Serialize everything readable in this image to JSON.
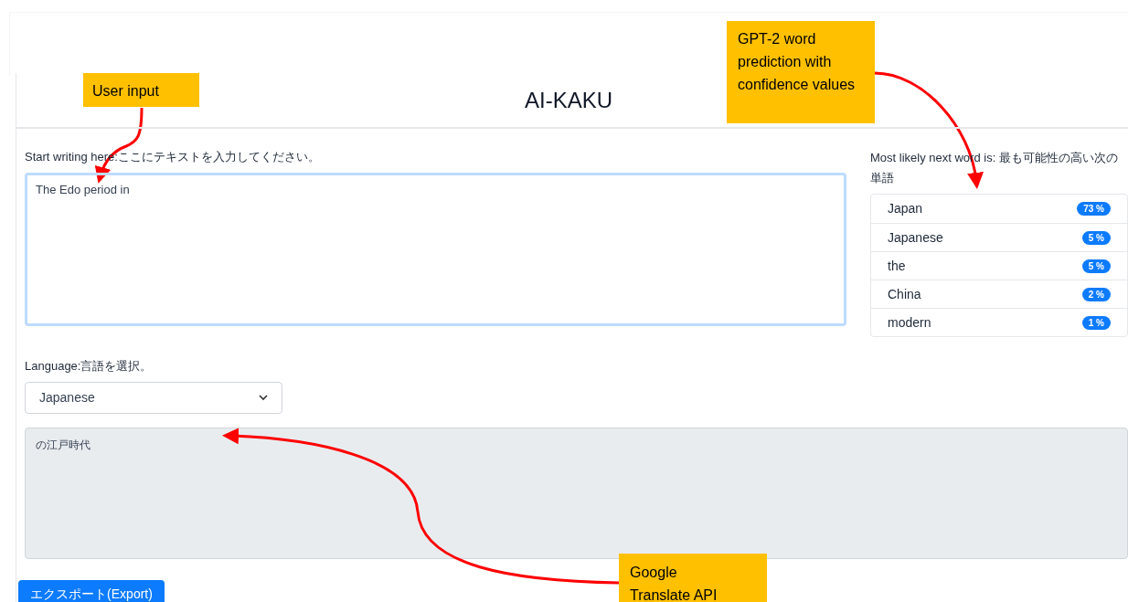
{
  "header": {
    "title": "AI-KAKU"
  },
  "input": {
    "label": "Start writing here:ここにテキストを入力してください。",
    "value": "The Edo period in"
  },
  "predictions": {
    "label": "Most likely next word is: 最も可能性の高い次の単語",
    "items": [
      {
        "word": "Japan",
        "confidence": "73 %"
      },
      {
        "word": "Japanese",
        "confidence": "5 %"
      },
      {
        "word": "the",
        "confidence": "5 %"
      },
      {
        "word": "China",
        "confidence": "2 %"
      },
      {
        "word": "modern",
        "confidence": "1 %"
      }
    ]
  },
  "language": {
    "label": "Language:言語を選択。",
    "value": "Japanese"
  },
  "translation": {
    "value": "の江戸時代"
  },
  "export_button": "エクスポート(Export)",
  "annotations": [
    {
      "kind": "input",
      "text": "User input"
    },
    {
      "kind": "prediction",
      "text": "GPT-2 word prediction with confidence values"
    },
    {
      "kind": "translate",
      "text": "Google Translate API"
    }
  ]
}
